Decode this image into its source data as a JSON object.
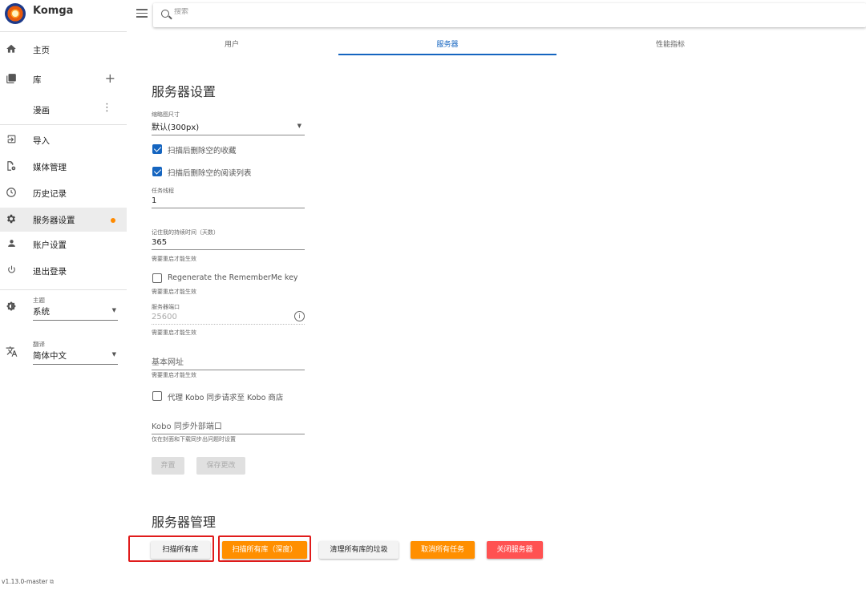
{
  "app": {
    "name": "Komga"
  },
  "search": {
    "placeholder": "搜索"
  },
  "sidebar": {
    "items": [
      {
        "label": "主页"
      },
      {
        "label": "库"
      },
      {
        "label": "漫画"
      },
      {
        "label": "导入"
      },
      {
        "label": "媒体管理"
      },
      {
        "label": "历史记录"
      },
      {
        "label": "服务器设置"
      },
      {
        "label": "账户设置"
      },
      {
        "label": "退出登录"
      }
    ],
    "theme": {
      "caption": "主题",
      "value": "系统"
    },
    "language": {
      "caption": "翻译",
      "value": "简体中文"
    },
    "version": "v1.13.0-master"
  },
  "tabs": [
    {
      "label": "用户"
    },
    {
      "label": "服务器"
    },
    {
      "label": "性能指标"
    }
  ],
  "settings": {
    "title": "服务器设置",
    "thumbnail": {
      "caption": "缩略图尺寸",
      "value": "默认(300px)"
    },
    "delete_empty_collections": {
      "label": "扫描后删除空的收藏",
      "checked": true
    },
    "delete_empty_readlists": {
      "label": "扫描后删除空的阅读列表",
      "checked": true
    },
    "task_threads": {
      "caption": "任务线程",
      "value": "1"
    },
    "remember_me": {
      "caption": "记住我的持续时间（天数）",
      "value": "365",
      "hint": "需要重启才能生效"
    },
    "regenerate_key": {
      "label": "Regenerate the RememberMe key",
      "checked": false,
      "hint": "需要重启才能生效"
    },
    "server_port": {
      "caption": "服务器端口",
      "value": "25600",
      "hint": "需要重启才能生效"
    },
    "base_url": {
      "placeholder": "基本网址",
      "hint": "需要重启才能生效"
    },
    "kobo_proxy": {
      "label": "代理 Kobo 同步请求至 Kobo 商店",
      "checked": false
    },
    "kobo_port": {
      "placeholder": "Kobo 同步外部端口",
      "hint": "仅在封面和下载同步出问题时设置"
    },
    "discard_label": "弃置",
    "save_label": "保存更改"
  },
  "management": {
    "title": "服务器管理",
    "buttons": [
      {
        "label": "扫描所有库"
      },
      {
        "label": "扫描所有库（深度）"
      },
      {
        "label": "清理所有库的垃圾"
      },
      {
        "label": "取消所有任务"
      },
      {
        "label": "关闭服务器"
      }
    ]
  },
  "colors": {
    "accent": "#1565c0",
    "warning": "#ff8f00",
    "danger": "#ff5252",
    "highlight": "#e01b1b"
  }
}
